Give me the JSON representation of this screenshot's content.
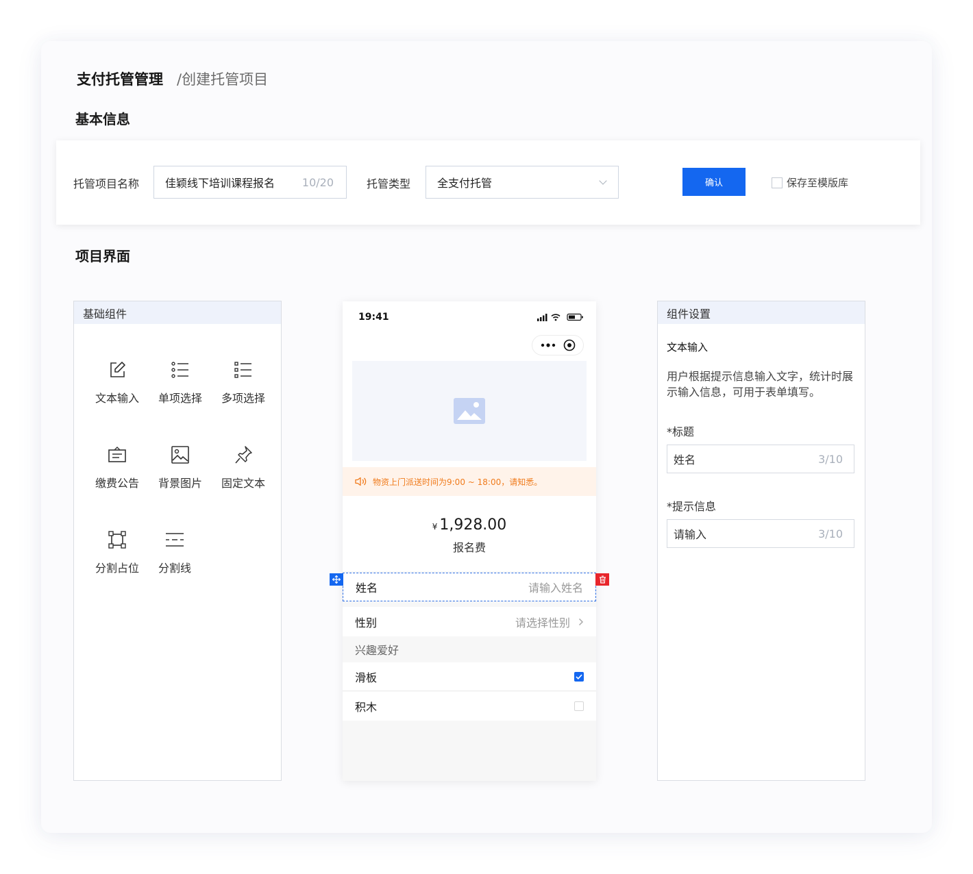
{
  "breadcrumb": {
    "main": "支付托管管理",
    "sub": "/创建托管项目"
  },
  "sections": {
    "basic_info": "基本信息",
    "project_ui": "项目界面"
  },
  "basic_form": {
    "name_label": "托管项目名称",
    "name_value": "佳颖线下培训课程报名",
    "name_counter": "10/20",
    "type_label": "托管类型",
    "type_value": "全支付托管",
    "confirm_label": "确认",
    "save_template_label": "保存至模版库",
    "save_template_checked": false
  },
  "components_panel": {
    "title": "基础组件",
    "items": [
      {
        "label": "文本输入",
        "icon": "edit-icon"
      },
      {
        "label": "单项选择",
        "icon": "single-choice-list-icon"
      },
      {
        "label": "多项选择",
        "icon": "multi-choice-list-icon"
      },
      {
        "label": "缴费公告",
        "icon": "announcement-icon"
      },
      {
        "label": "背景图片",
        "icon": "image-icon"
      },
      {
        "label": "固定文本",
        "icon": "pin-icon"
      },
      {
        "label": "分割占位",
        "icon": "placeholder-frame-icon"
      },
      {
        "label": "分割线",
        "icon": "divider-icon"
      }
    ]
  },
  "phone": {
    "time": "19:41",
    "notice": "物资上门派送时间为9:00 ~ 18:00，请知悉。",
    "currency": "¥",
    "price": "1,928.00",
    "price_label": "报名费",
    "fields": [
      {
        "label": "姓名",
        "placeholder": "请输入姓名",
        "selected": true
      },
      {
        "label": "性别",
        "placeholder": "请选择性别"
      }
    ],
    "group_title": "兴趣爱好",
    "options": [
      {
        "label": "滑板",
        "checked": true
      },
      {
        "label": "积木",
        "checked": false
      }
    ]
  },
  "settings_panel": {
    "title": "组件设置",
    "component_name": "文本输入",
    "description": "用户根据提示信息输入文字，统计时展示输入信息，可用于表单填写。",
    "title_label": "*标题",
    "title_value": "姓名",
    "title_counter": "3/10",
    "hint_label": "*提示信息",
    "hint_value": "请输入",
    "hint_counter": "3/10"
  },
  "colors": {
    "accent": "#1467f0",
    "danger": "#e8262c",
    "notice": "#f07b1c",
    "notice_bg": "#fff3ea"
  }
}
